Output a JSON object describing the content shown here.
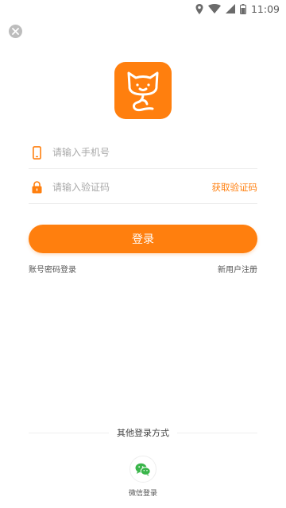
{
  "status_bar": {
    "time": "11:09",
    "icons": [
      "location-icon",
      "wifi-icon",
      "signal-icon",
      "battery-icon"
    ]
  },
  "colors": {
    "accent": "#ff7f0e",
    "placeholder": "#a8a8a8",
    "close_bg": "#bdbdbd",
    "wechat_green": "#3ab54a"
  },
  "close_button": {
    "icon": "close-icon"
  },
  "logo": {
    "icon": "cat-logo-icon"
  },
  "form": {
    "phone_placeholder": "请输入手机号",
    "phone_value": "",
    "code_placeholder": "请输入验证码",
    "code_value": "",
    "get_code_label": "获取验证码"
  },
  "login_button_label": "登录",
  "links": {
    "password_login": "账号密码登录",
    "register": "新用户注册"
  },
  "other_login": {
    "title": "其他登录方式",
    "wechat_label": "微信登录"
  }
}
